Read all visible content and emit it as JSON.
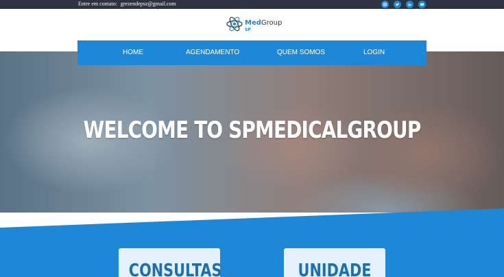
{
  "topbar": {
    "contact_label": "Entre em contato:",
    "contact_email": "grezendepsz@gmail.com",
    "social_icons": [
      "instagram-icon",
      "twitter-icon",
      "linkedin-icon",
      "youtube-icon"
    ],
    "icon_color": "#1e88d8"
  },
  "logo": {
    "med": "Med",
    "group": "Group",
    "sp": "SP",
    "icon": "atom-icon"
  },
  "nav": {
    "items": [
      {
        "label": "HOME"
      },
      {
        "label": "AGENDAMENTO"
      },
      {
        "label": "QUEM SOMOS"
      },
      {
        "label": "LOGIN"
      }
    ],
    "background": "#1e88d8"
  },
  "hero": {
    "title": "WELCOME TO SPMEDICALGROUP"
  },
  "cards": [
    {
      "title": "CONSULTAS"
    },
    {
      "title": "UNIDADE"
    }
  ],
  "colors": {
    "primary": "#1e88d8",
    "topbar": "#2e3340",
    "card": "#e4f0fa"
  }
}
